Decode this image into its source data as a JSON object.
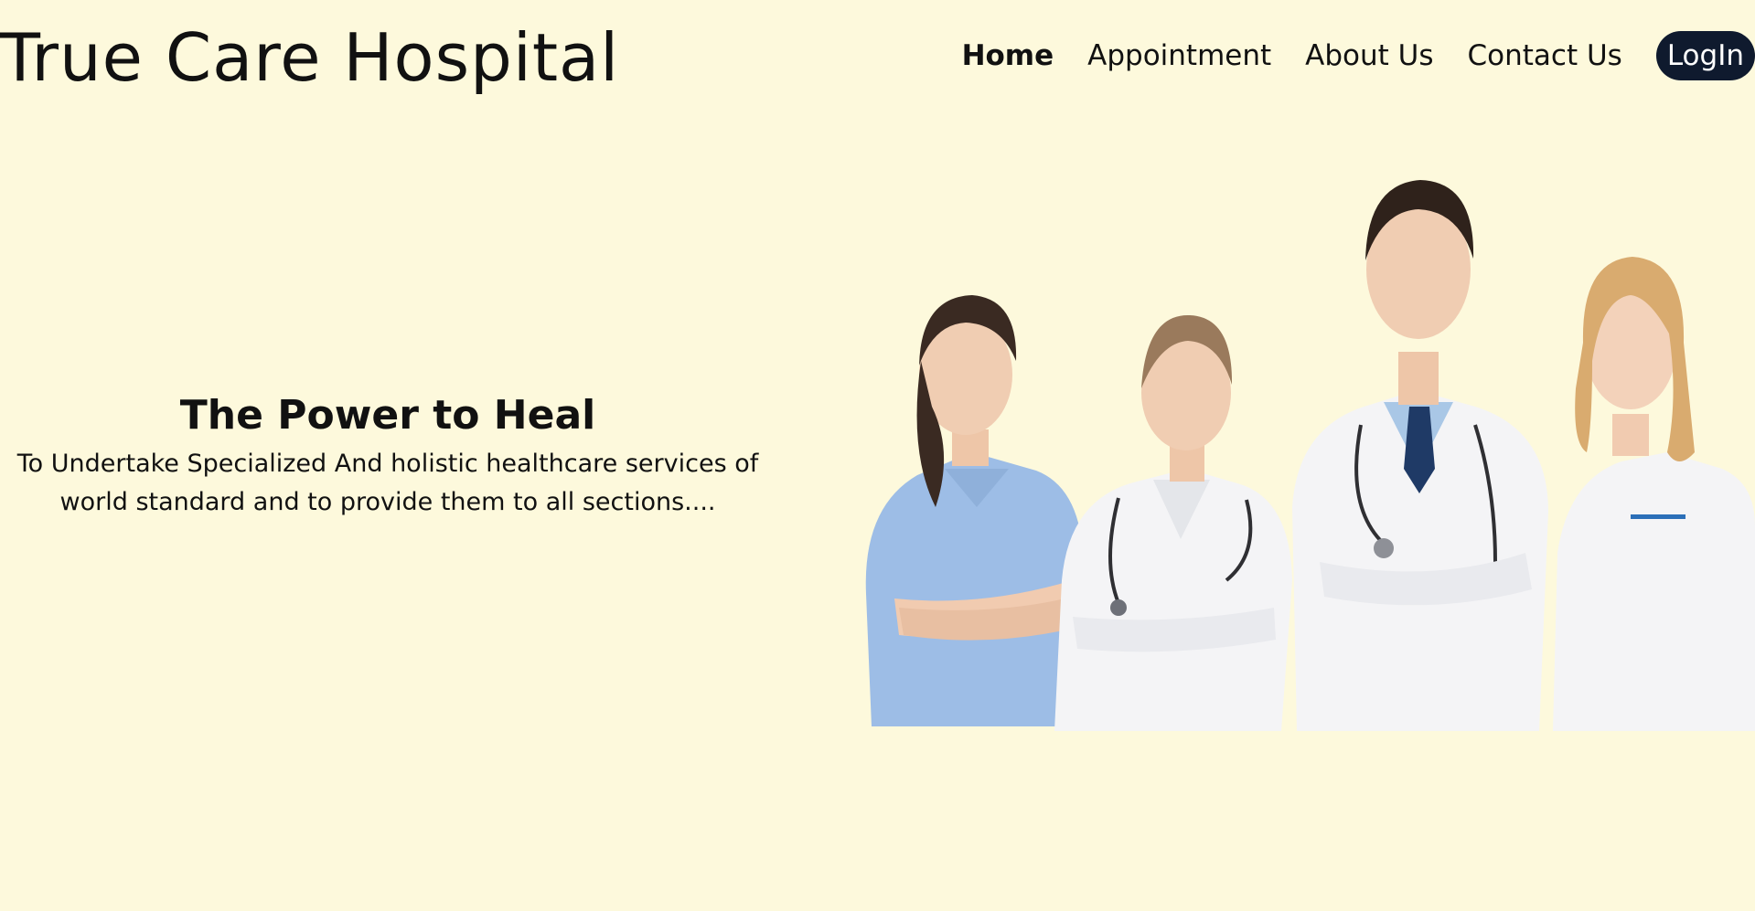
{
  "header": {
    "title": "True Care Hospital",
    "nav": [
      {
        "label": "Home",
        "active": true
      },
      {
        "label": "Appointment",
        "active": false
      },
      {
        "label": "About Us",
        "active": false
      },
      {
        "label": "Contact Us",
        "active": false
      }
    ],
    "login_label": "LogIn"
  },
  "hero": {
    "heading": "The Power to Heal",
    "description": "To Undertake Specialized And holistic healthcare services of world standard and to provide them to all sections....",
    "image_icon": "medical-staff-photo"
  },
  "colors": {
    "background": "#fdf9dc",
    "login_button": "#0f1a2e",
    "scrubs_blue": "#9dbde6",
    "coat_white": "#f4f4f6"
  }
}
